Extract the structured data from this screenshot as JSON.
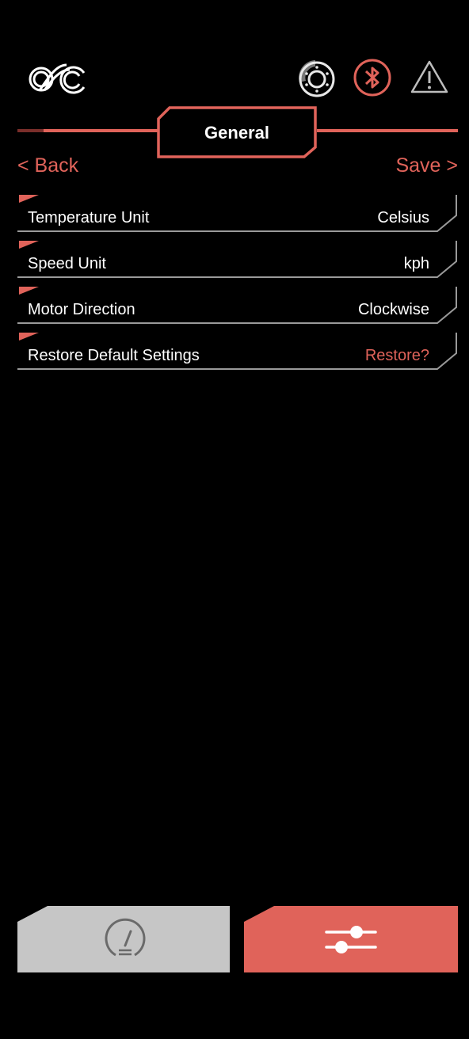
{
  "header": {
    "title": "General",
    "back_label": "< Back",
    "save_label": "Save >"
  },
  "status_icons": [
    "brake-disc-icon",
    "bluetooth-icon",
    "warning-icon"
  ],
  "settings": [
    {
      "label": "Temperature Unit",
      "value": "Celsius"
    },
    {
      "label": "Speed Unit",
      "value": "kph"
    },
    {
      "label": "Motor Direction",
      "value": "Clockwise"
    },
    {
      "label": "Restore Default Settings",
      "value": "Restore?"
    }
  ],
  "tabs": [
    {
      "icon": "speedometer-icon",
      "active": false
    },
    {
      "icon": "sliders-icon",
      "active": true
    }
  ],
  "colors": {
    "accent": "#e0635a",
    "inactive_tab": "#c6c6c6",
    "background": "#000000"
  }
}
